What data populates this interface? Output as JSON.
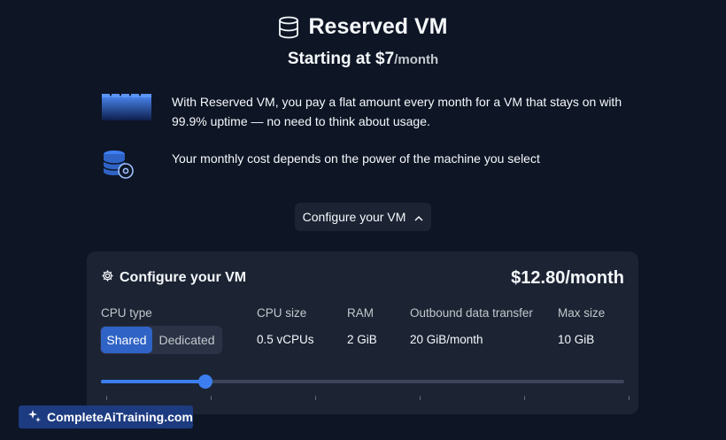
{
  "hero": {
    "title": "Reserved VM",
    "subtitle_prefix": "Starting at $7",
    "subtitle_unit": "/month"
  },
  "features": [
    {
      "icon": "uptime-bars-icon",
      "text": "With Reserved VM, you pay a flat amount every month for a VM that stays on with 99.9% uptime — no need to think about usage."
    },
    {
      "icon": "database-settings-icon",
      "text": "Your monthly cost depends on the power of the machine you select"
    }
  ],
  "config_toggle": {
    "label": "Configure your VM",
    "icon": "chevron-up-icon"
  },
  "panel": {
    "title": "Configure your VM",
    "price": "$12.80/month",
    "columns": {
      "cpu_type": "CPU type",
      "cpu_size": "CPU size",
      "ram": "RAM",
      "transfer": "Outbound data transfer",
      "max_size": "Max size"
    },
    "cpu_type_options": [
      "Shared",
      "Dedicated"
    ],
    "cpu_type_selected": "Shared",
    "values": {
      "cpu_size": "0.5 vCPUs",
      "ram": "2 GiB",
      "transfer": "20 GiB/month",
      "max_size": "10 GiB"
    },
    "slider": {
      "steps": 6,
      "selected_index": 1
    }
  },
  "watermark": {
    "text": "CompleteAiTraining.com",
    "icon": "sparkle-logo-icon"
  },
  "colors": {
    "background": "#0e1525",
    "panel": "#1c2333",
    "accent": "#3c7ef0",
    "selected": "#2f63c6"
  }
}
